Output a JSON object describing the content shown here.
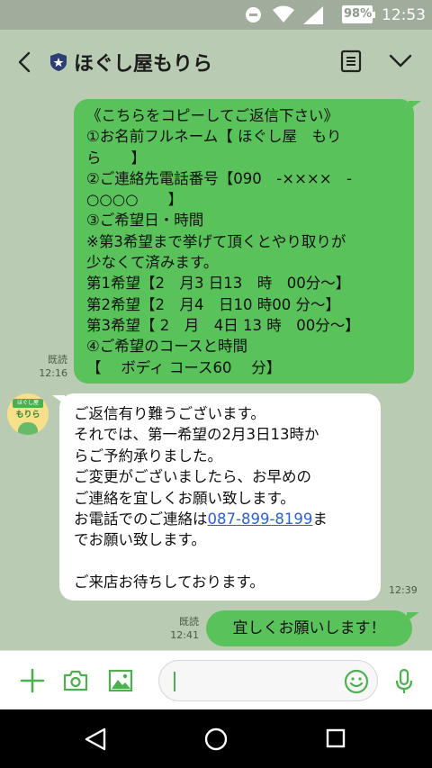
{
  "status_bar": {
    "battery": "98%",
    "time": "12:53"
  },
  "header": {
    "title": "ほぐし屋もりら",
    "icons": [
      "back-arrow-icon",
      "shield-star-icon",
      "notes-icon",
      "chevron-down-icon"
    ]
  },
  "messages": [
    {
      "direction": "outgoing",
      "lines": [
        "《こちらをコピーしてご返信下さい》",
        "①お名前フルネーム【 ほぐし屋　もり",
        "ら　　】",
        "②ご連絡先電話番号【090　-××××　-",
        "○○○○　　】",
        "③ご希望日・時間",
        "※第3希望まで挙げて頂くとやり取りが",
        "少なくて済みます。",
        "第1希望【2　月3 日13　時　00分〜】",
        "第2希望【2　月4　日10 時00 分〜】",
        "第3希望【 2　月　4日 13 時　00分〜】",
        "④ご希望のコースと時間",
        "【　 ボディ コース60　  分】"
      ],
      "read_label": "既読",
      "time": "12:16"
    },
    {
      "direction": "incoming",
      "lines": [
        "ご返信有り難うございます。",
        "それでは、第一希望の2月3日13時か",
        "らご予約承りました。",
        "ご変更がございましたら、お早めの",
        "ご連絡を宜しくお願い致します。"
      ],
      "phone_prefix": "お電話でのご連絡は",
      "phone": "087-899-8199",
      "phone_suffix": "ま",
      "line_after_phone": "でお願い致します。",
      "closing": "ご来店お待ちしております。",
      "time": "12:39"
    },
    {
      "direction": "outgoing",
      "text": "宜しくお願いします！",
      "read_label": "既読",
      "time": "12:41"
    }
  ],
  "avatar": {
    "top_text": "ほぐし屋",
    "name_text": "もりら"
  },
  "input_bar": {
    "placeholder": "",
    "icons": [
      "plus-icon",
      "camera-icon",
      "image-icon",
      "emoji-icon",
      "mic-icon"
    ]
  },
  "nav_bar": {
    "icons": [
      "nav-back-icon",
      "nav-home-icon",
      "nav-recent-icon"
    ]
  },
  "colors": {
    "chat_background": "#b9cbb2",
    "status_bar": "#a1ad9c",
    "outgoing_bubble": "#5ac25a",
    "incoming_bubble": "#ffffff",
    "accent_green": "#4caf50",
    "link": "#3060d0"
  }
}
